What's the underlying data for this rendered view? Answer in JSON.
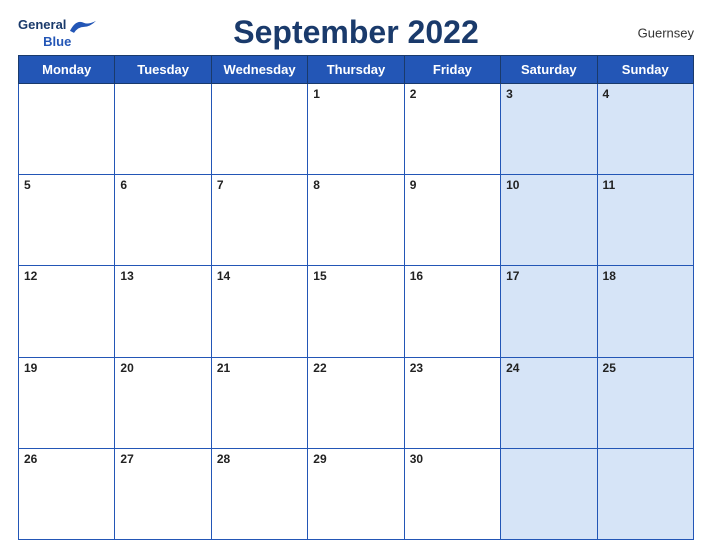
{
  "header": {
    "logo_general": "General",
    "logo_blue": "Blue",
    "month_title": "September 2022",
    "country": "Guernsey"
  },
  "days_of_week": [
    "Monday",
    "Tuesday",
    "Wednesday",
    "Thursday",
    "Friday",
    "Saturday",
    "Sunday"
  ],
  "weeks": [
    [
      {
        "num": "",
        "shaded": false,
        "empty": true
      },
      {
        "num": "",
        "shaded": false,
        "empty": true
      },
      {
        "num": "",
        "shaded": false,
        "empty": true
      },
      {
        "num": "1",
        "shaded": false
      },
      {
        "num": "2",
        "shaded": false
      },
      {
        "num": "3",
        "shaded": true
      },
      {
        "num": "4",
        "shaded": true
      }
    ],
    [
      {
        "num": "5",
        "shaded": false
      },
      {
        "num": "6",
        "shaded": false
      },
      {
        "num": "7",
        "shaded": false
      },
      {
        "num": "8",
        "shaded": false
      },
      {
        "num": "9",
        "shaded": false
      },
      {
        "num": "10",
        "shaded": true
      },
      {
        "num": "11",
        "shaded": true
      }
    ],
    [
      {
        "num": "12",
        "shaded": false
      },
      {
        "num": "13",
        "shaded": false
      },
      {
        "num": "14",
        "shaded": false
      },
      {
        "num": "15",
        "shaded": false
      },
      {
        "num": "16",
        "shaded": false
      },
      {
        "num": "17",
        "shaded": true
      },
      {
        "num": "18",
        "shaded": true
      }
    ],
    [
      {
        "num": "19",
        "shaded": false
      },
      {
        "num": "20",
        "shaded": false
      },
      {
        "num": "21",
        "shaded": false
      },
      {
        "num": "22",
        "shaded": false
      },
      {
        "num": "23",
        "shaded": false
      },
      {
        "num": "24",
        "shaded": true
      },
      {
        "num": "25",
        "shaded": true
      }
    ],
    [
      {
        "num": "26",
        "shaded": false
      },
      {
        "num": "27",
        "shaded": false
      },
      {
        "num": "28",
        "shaded": false
      },
      {
        "num": "29",
        "shaded": false
      },
      {
        "num": "30",
        "shaded": false
      },
      {
        "num": "",
        "shaded": true
      },
      {
        "num": "",
        "shaded": true
      }
    ]
  ]
}
